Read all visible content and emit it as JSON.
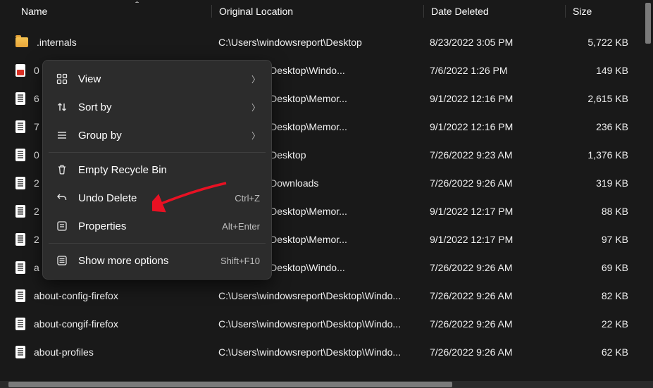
{
  "columns": {
    "name": "Name",
    "location": "Original Location",
    "date": "Date Deleted",
    "size": "Size"
  },
  "rows": [
    {
      "icon": "folder",
      "name": ".internals",
      "location": "C:\\Users\\windowsreport\\Desktop",
      "date": "8/23/2022 3:05 PM",
      "size": "5,722 KB"
    },
    {
      "icon": "pdf",
      "name": "0",
      "location": "dowsreport\\Desktop\\Windo...",
      "date": "7/6/2022 1:26 PM",
      "size": "149 KB"
    },
    {
      "icon": "file",
      "name": "6",
      "location": "dowsreport\\Desktop\\Memor...",
      "date": "9/1/2022 12:16 PM",
      "size": "2,615 KB"
    },
    {
      "icon": "file",
      "name": "7",
      "location": "dowsreport\\Desktop\\Memor...",
      "date": "9/1/2022 12:16 PM",
      "size": "236 KB"
    },
    {
      "icon": "file",
      "name": "0",
      "location": "dowsreport\\Desktop",
      "date": "7/26/2022 9:23 AM",
      "size": "1,376 KB"
    },
    {
      "icon": "file",
      "name": "2",
      "location": "dowsreport\\Downloads",
      "date": "7/26/2022 9:26 AM",
      "size": "319 KB"
    },
    {
      "icon": "file",
      "name": "2",
      "location": "dowsreport\\Desktop\\Memor...",
      "date": "9/1/2022 12:17 PM",
      "size": "88 KB"
    },
    {
      "icon": "file",
      "name": "2",
      "location": "dowsreport\\Desktop\\Memor...",
      "date": "9/1/2022 12:17 PM",
      "size": "97 KB"
    },
    {
      "icon": "file",
      "name": "a",
      "location": "dowsreport\\Desktop\\Windo...",
      "date": "7/26/2022 9:26 AM",
      "size": "69 KB"
    },
    {
      "icon": "file",
      "name": "about-config-firefox",
      "location": "C:\\Users\\windowsreport\\Desktop\\Windo...",
      "date": "7/26/2022 9:26 AM",
      "size": "82 KB"
    },
    {
      "icon": "file",
      "name": "about-congif-firefox",
      "location": "C:\\Users\\windowsreport\\Desktop\\Windo...",
      "date": "7/26/2022 9:26 AM",
      "size": "22 KB"
    },
    {
      "icon": "file",
      "name": "about-profiles",
      "location": "C:\\Users\\windowsreport\\Desktop\\Windo...",
      "date": "7/26/2022 9:26 AM",
      "size": "62 KB"
    }
  ],
  "menu": {
    "view": "View",
    "sort": "Sort by",
    "group": "Group by",
    "empty": "Empty Recycle Bin",
    "undo": "Undo Delete",
    "undo_shortcut": "Ctrl+Z",
    "properties": "Properties",
    "properties_shortcut": "Alt+Enter",
    "more": "Show more options",
    "more_shortcut": "Shift+F10"
  }
}
